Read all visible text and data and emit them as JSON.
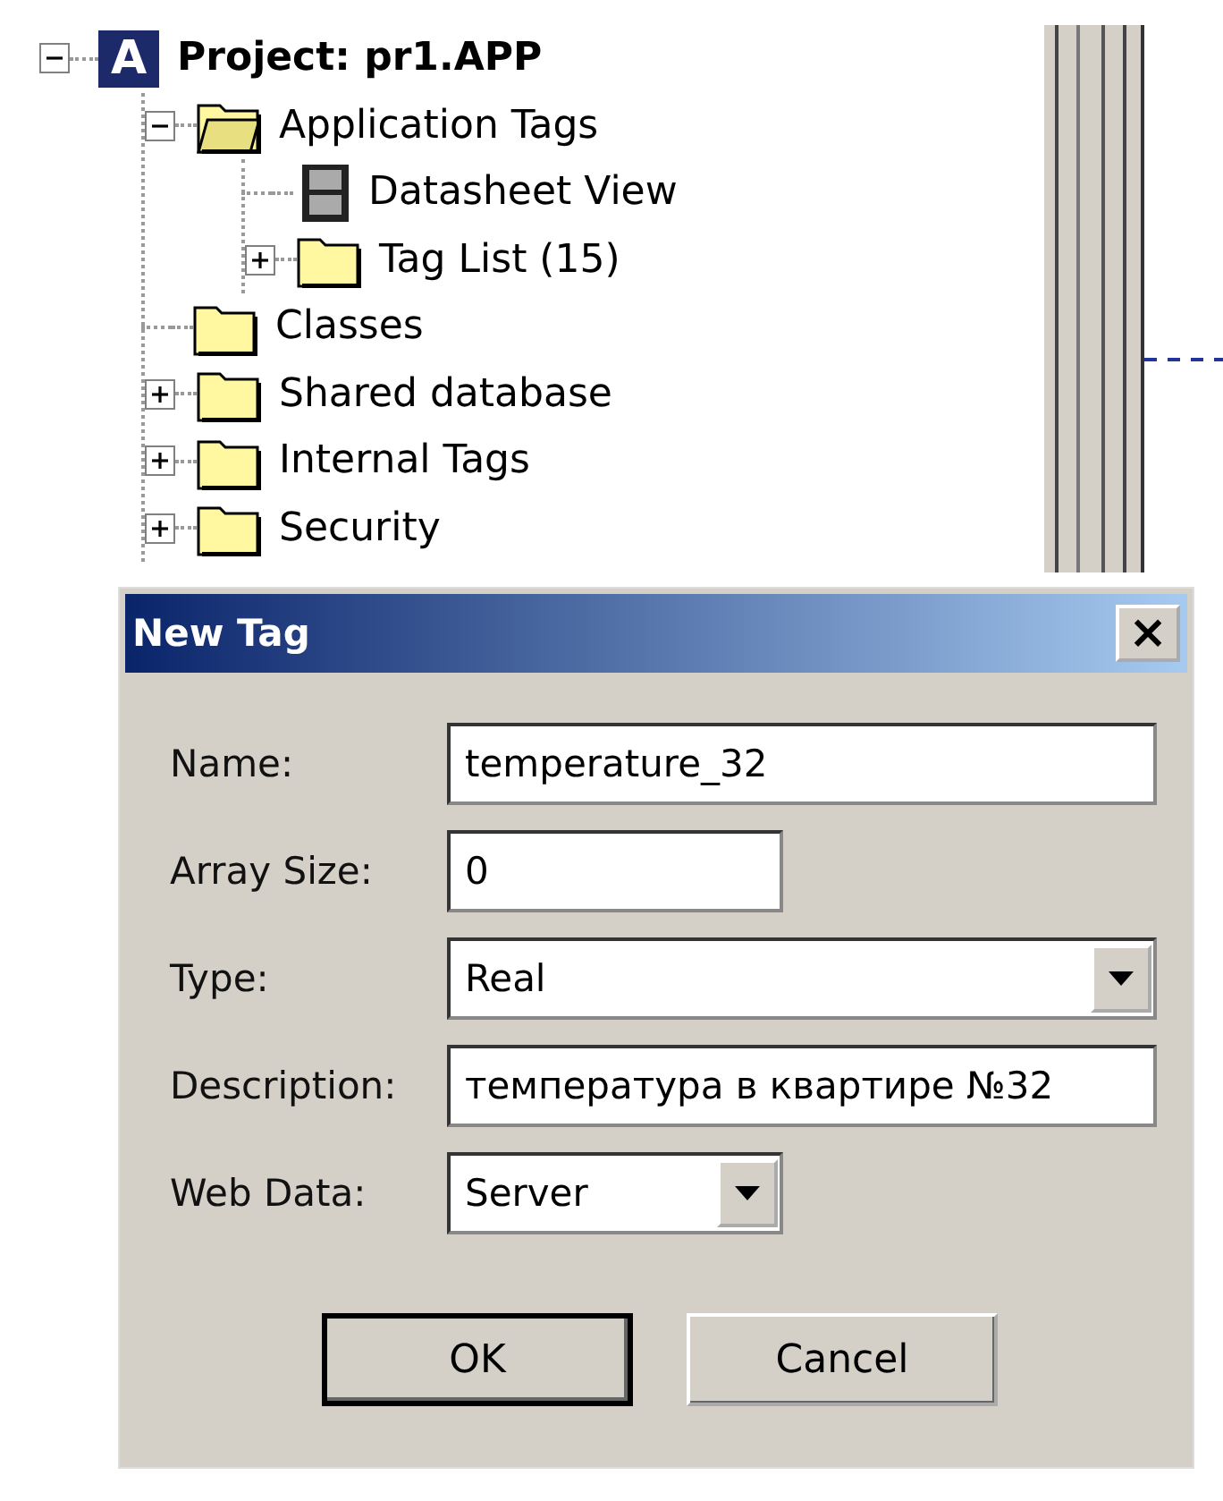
{
  "tree": [
    {
      "label": "Project: pr1.APP",
      "kind": "project",
      "expanded": true,
      "logo": "A",
      "children": [
        {
          "label": "Application Tags",
          "kind": "open-folder",
          "expanded": true,
          "children": [
            {
              "label": "Datasheet View",
              "kind": "datasheet"
            },
            {
              "label": "Tag List (15)",
              "kind": "folder",
              "expanded": false
            }
          ]
        },
        {
          "label": "Classes",
          "kind": "folder"
        },
        {
          "label": "Shared database",
          "kind": "folder",
          "expanded": false
        },
        {
          "label": "Internal Tags",
          "kind": "folder",
          "expanded": false
        },
        {
          "label": "Security",
          "kind": "folder",
          "expanded": false
        }
      ]
    }
  ],
  "dialog": {
    "title": "New Tag",
    "close": "×",
    "fields": [
      {
        "label": "Name:",
        "kind": "text",
        "value": "temperature_32"
      },
      {
        "label": "Array Size:",
        "kind": "text",
        "value": "0"
      },
      {
        "label": "Type:",
        "kind": "select",
        "value": "Real"
      },
      {
        "label": "Description:",
        "kind": "text",
        "value": "температура в квартире №32"
      },
      {
        "label": "Web Data:",
        "kind": "select",
        "value": "Server"
      }
    ],
    "buttons": [
      {
        "label": "OK",
        "default": true
      },
      {
        "label": "Cancel",
        "default": false
      }
    ]
  }
}
